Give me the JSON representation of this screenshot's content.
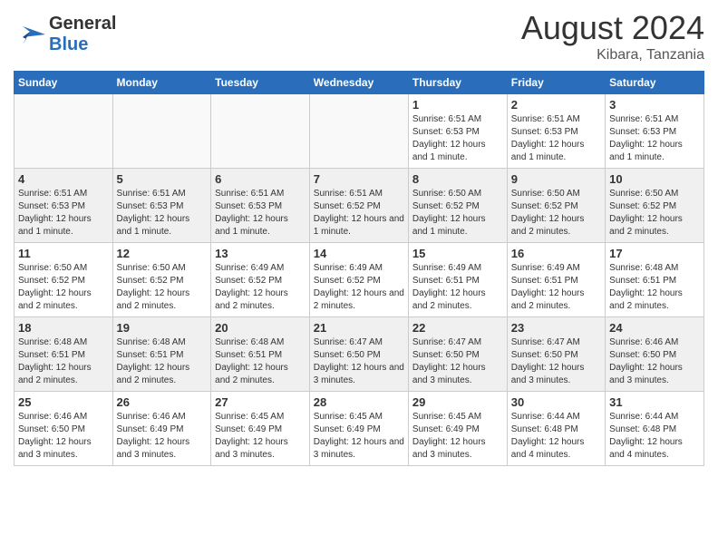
{
  "header": {
    "logo_line1": "General",
    "logo_line2": "Blue",
    "month_year": "August 2024",
    "location": "Kibara, Tanzania"
  },
  "weekdays": [
    "Sunday",
    "Monday",
    "Tuesday",
    "Wednesday",
    "Thursday",
    "Friday",
    "Saturday"
  ],
  "weeks": [
    {
      "days": [
        {
          "num": "",
          "info": ""
        },
        {
          "num": "",
          "info": ""
        },
        {
          "num": "",
          "info": ""
        },
        {
          "num": "",
          "info": ""
        },
        {
          "num": "1",
          "info": "Sunrise: 6:51 AM\nSunset: 6:53 PM\nDaylight: 12 hours and 1 minute."
        },
        {
          "num": "2",
          "info": "Sunrise: 6:51 AM\nSunset: 6:53 PM\nDaylight: 12 hours and 1 minute."
        },
        {
          "num": "3",
          "info": "Sunrise: 6:51 AM\nSunset: 6:53 PM\nDaylight: 12 hours and 1 minute."
        }
      ]
    },
    {
      "days": [
        {
          "num": "4",
          "info": "Sunrise: 6:51 AM\nSunset: 6:53 PM\nDaylight: 12 hours and 1 minute."
        },
        {
          "num": "5",
          "info": "Sunrise: 6:51 AM\nSunset: 6:53 PM\nDaylight: 12 hours and 1 minute."
        },
        {
          "num": "6",
          "info": "Sunrise: 6:51 AM\nSunset: 6:53 PM\nDaylight: 12 hours and 1 minute."
        },
        {
          "num": "7",
          "info": "Sunrise: 6:51 AM\nSunset: 6:52 PM\nDaylight: 12 hours and 1 minute."
        },
        {
          "num": "8",
          "info": "Sunrise: 6:50 AM\nSunset: 6:52 PM\nDaylight: 12 hours and 1 minute."
        },
        {
          "num": "9",
          "info": "Sunrise: 6:50 AM\nSunset: 6:52 PM\nDaylight: 12 hours and 2 minutes."
        },
        {
          "num": "10",
          "info": "Sunrise: 6:50 AM\nSunset: 6:52 PM\nDaylight: 12 hours and 2 minutes."
        }
      ]
    },
    {
      "days": [
        {
          "num": "11",
          "info": "Sunrise: 6:50 AM\nSunset: 6:52 PM\nDaylight: 12 hours and 2 minutes."
        },
        {
          "num": "12",
          "info": "Sunrise: 6:50 AM\nSunset: 6:52 PM\nDaylight: 12 hours and 2 minutes."
        },
        {
          "num": "13",
          "info": "Sunrise: 6:49 AM\nSunset: 6:52 PM\nDaylight: 12 hours and 2 minutes."
        },
        {
          "num": "14",
          "info": "Sunrise: 6:49 AM\nSunset: 6:52 PM\nDaylight: 12 hours and 2 minutes."
        },
        {
          "num": "15",
          "info": "Sunrise: 6:49 AM\nSunset: 6:51 PM\nDaylight: 12 hours and 2 minutes."
        },
        {
          "num": "16",
          "info": "Sunrise: 6:49 AM\nSunset: 6:51 PM\nDaylight: 12 hours and 2 minutes."
        },
        {
          "num": "17",
          "info": "Sunrise: 6:48 AM\nSunset: 6:51 PM\nDaylight: 12 hours and 2 minutes."
        }
      ]
    },
    {
      "days": [
        {
          "num": "18",
          "info": "Sunrise: 6:48 AM\nSunset: 6:51 PM\nDaylight: 12 hours and 2 minutes."
        },
        {
          "num": "19",
          "info": "Sunrise: 6:48 AM\nSunset: 6:51 PM\nDaylight: 12 hours and 2 minutes."
        },
        {
          "num": "20",
          "info": "Sunrise: 6:48 AM\nSunset: 6:51 PM\nDaylight: 12 hours and 2 minutes."
        },
        {
          "num": "21",
          "info": "Sunrise: 6:47 AM\nSunset: 6:50 PM\nDaylight: 12 hours and 3 minutes."
        },
        {
          "num": "22",
          "info": "Sunrise: 6:47 AM\nSunset: 6:50 PM\nDaylight: 12 hours and 3 minutes."
        },
        {
          "num": "23",
          "info": "Sunrise: 6:47 AM\nSunset: 6:50 PM\nDaylight: 12 hours and 3 minutes."
        },
        {
          "num": "24",
          "info": "Sunrise: 6:46 AM\nSunset: 6:50 PM\nDaylight: 12 hours and 3 minutes."
        }
      ]
    },
    {
      "days": [
        {
          "num": "25",
          "info": "Sunrise: 6:46 AM\nSunset: 6:50 PM\nDaylight: 12 hours and 3 minutes."
        },
        {
          "num": "26",
          "info": "Sunrise: 6:46 AM\nSunset: 6:49 PM\nDaylight: 12 hours and 3 minutes."
        },
        {
          "num": "27",
          "info": "Sunrise: 6:45 AM\nSunset: 6:49 PM\nDaylight: 12 hours and 3 minutes."
        },
        {
          "num": "28",
          "info": "Sunrise: 6:45 AM\nSunset: 6:49 PM\nDaylight: 12 hours and 3 minutes."
        },
        {
          "num": "29",
          "info": "Sunrise: 6:45 AM\nSunset: 6:49 PM\nDaylight: 12 hours and 3 minutes."
        },
        {
          "num": "30",
          "info": "Sunrise: 6:44 AM\nSunset: 6:48 PM\nDaylight: 12 hours and 4 minutes."
        },
        {
          "num": "31",
          "info": "Sunrise: 6:44 AM\nSunset: 6:48 PM\nDaylight: 12 hours and 4 minutes."
        }
      ]
    }
  ]
}
